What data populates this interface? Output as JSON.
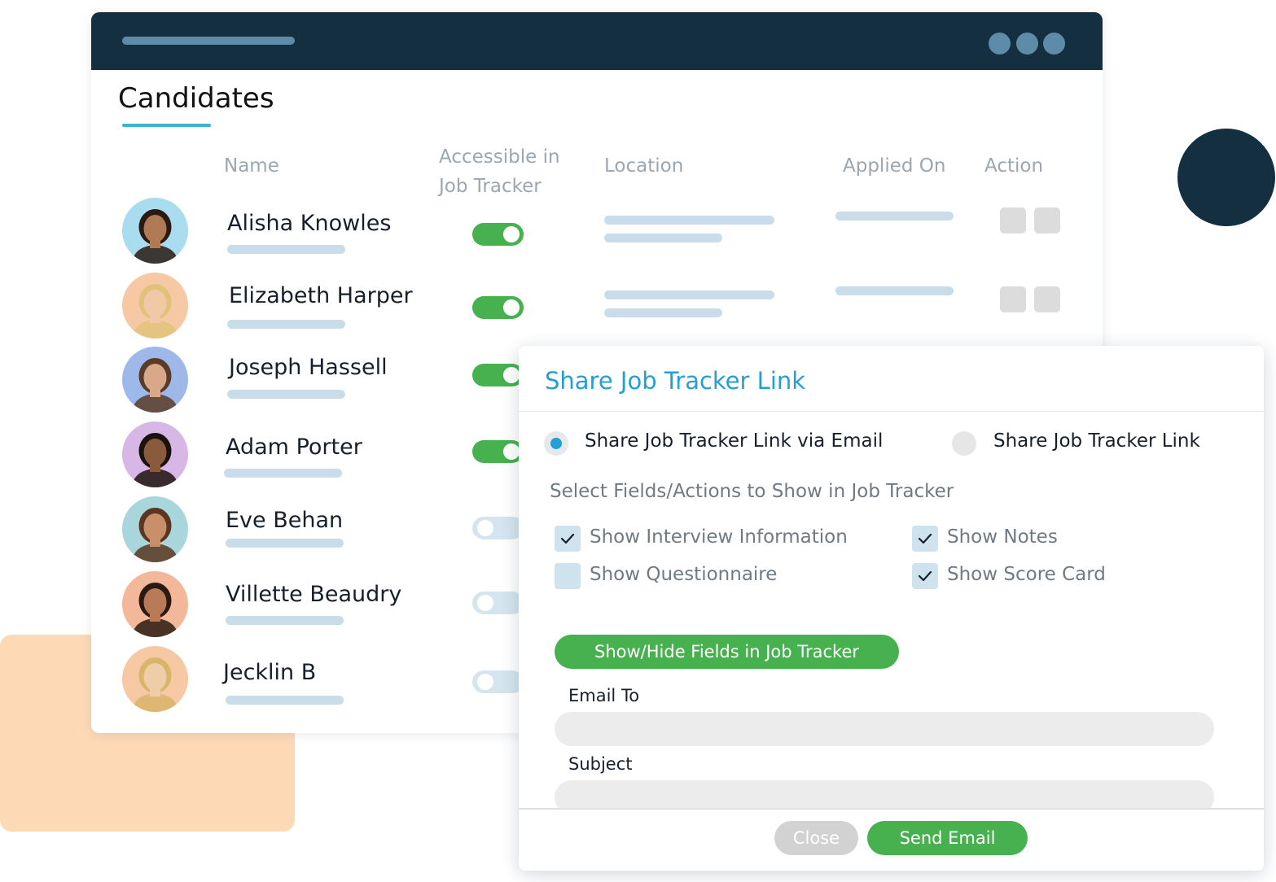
{
  "page": {
    "title": "Candidates"
  },
  "table": {
    "headers": {
      "name": "Name",
      "accessible": "Accessible in Job Tracker",
      "location": "Location",
      "applied_on": "Applied On",
      "action": "Action"
    },
    "rows": [
      {
        "name": "Alisha Knowles",
        "accessible": true,
        "avatar_bg": "#a9dcef",
        "skin": "#b07a55",
        "hair": "#2a1a12"
      },
      {
        "name": "Elizabeth Harper",
        "accessible": true,
        "avatar_bg": "#f6c9a4",
        "skin": "#f1c9a6",
        "hair": "#e2c27a"
      },
      {
        "name": "Joseph Hassell",
        "accessible": true,
        "avatar_bg": "#9fb8ea",
        "skin": "#d9a888",
        "hair": "#5a3b27"
      },
      {
        "name": "Adam Porter",
        "accessible": true,
        "avatar_bg": "#d7b7e6",
        "skin": "#8a5a3c",
        "hair": "#1c120c"
      },
      {
        "name": "Eve Behan",
        "accessible": false,
        "avatar_bg": "#a9d6dc",
        "skin": "#c98f68",
        "hair": "#5a3620"
      },
      {
        "name": "Villette Beaudry",
        "accessible": false,
        "avatar_bg": "#f3b79a",
        "skin": "#b97b57",
        "hair": "#2a1a12"
      },
      {
        "name": "Jecklin B",
        "accessible": false,
        "avatar_bg": "#f6c9a4",
        "skin": "#f0cda9",
        "hair": "#d9b56a"
      }
    ]
  },
  "modal": {
    "title": "Share Job Tracker Link",
    "options": {
      "via_email": "Share Job Tracker Link via Email",
      "link": "Share Job Tracker Link",
      "selected": "via_email"
    },
    "fields_label": "Select Fields/Actions to Show in Job Tracker",
    "checkboxes": [
      {
        "label": "Show Interview Information",
        "checked": true
      },
      {
        "label": "Show Notes",
        "checked": true
      },
      {
        "label": "Show Questionnaire",
        "checked": false
      },
      {
        "label": "Show Score Card",
        "checked": true
      }
    ],
    "show_hide_button": "Show/Hide Fields in Job Tracker",
    "email_to_label": "Email To",
    "subject_label": "Subject",
    "close_button": "Close",
    "send_button": "Send Email"
  },
  "colors": {
    "dark": "#143040",
    "accent_blue": "#22a0d6",
    "green": "#46b14e",
    "peach": "#fdd9b5"
  }
}
